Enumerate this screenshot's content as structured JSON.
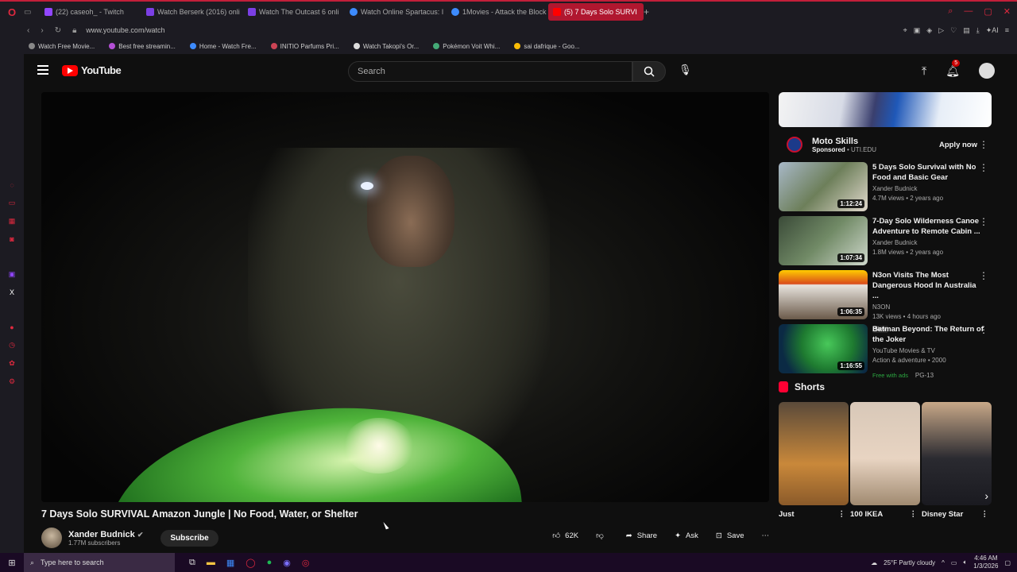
{
  "browser": {
    "tabs": [
      {
        "label": "(22) caseoh_ - Twitch",
        "color": "#9146ff"
      },
      {
        "label": "Watch Berserk (2016) onli",
        "color": "#7b3fe4"
      },
      {
        "label": "Watch The Outcast 6 onli",
        "color": "#7b3fe4"
      },
      {
        "label": "Watch Online Spartacus: I",
        "color": "#3d8bfd"
      },
      {
        "label": "1Movies - Attack the Block",
        "color": "#3d8bfd"
      },
      {
        "label": "(5) 7 Days Solo SURVI",
        "color": "#ff0000"
      }
    ],
    "url": "www.youtube.com/watch",
    "bookmarks": [
      "Watch Free Movie...",
      "Best free streamin...",
      "Home - Watch Fre...",
      "INITIO Parfums Pri...",
      "Watch Takopi's Or...",
      "Pokémon Voit Whi...",
      "sai dafrique - Goo..."
    ]
  },
  "youtube": {
    "logo": "YouTube",
    "search_placeholder": "Search",
    "notif_count": "5",
    "video": {
      "title": "7 Days Solo SURVIVAL Amazon Jungle | No Food, Water, or Shelter",
      "channel": "Xander Budnick",
      "subs": "1.77M subscribers",
      "subscribe": "Subscribe",
      "likes": "62K",
      "share": "Share",
      "ask": "Ask",
      "save": "Save"
    },
    "ad": {
      "name": "Moto Skills",
      "sponsored": "Sponsored",
      "domain": "UTI.EDU",
      "cta": "Apply now"
    },
    "recommendations": [
      {
        "title": "5 Days Solo Survival with No Food and Basic Gear",
        "channel": "Xander Budnick",
        "stats": "4.7M views • 2 years ago",
        "duration": "1:12:24"
      },
      {
        "title": "7-Day Solo Wilderness Canoe Adventure to Remote Cabin ...",
        "channel": "Xander Budnick",
        "stats": "1.8M views • 2 years ago",
        "duration": "1:07:34"
      },
      {
        "title": "N3on Visits The Most Dangerous Hood In Australia ...",
        "channel": "N3ON",
        "stats": "13K views • 4 hours ago",
        "duration": "1:06:35",
        "badge": "New"
      },
      {
        "title": "Batman Beyond: The Return of the Joker",
        "channel": "YouTube Movies & TV",
        "stats": "Action & adventure • 2000",
        "duration": "1:16:55",
        "free": "Free with ads",
        "rating": "PG-13"
      }
    ],
    "shorts_label": "Shorts",
    "shorts": [
      "Just",
      "100 IKEA",
      "Disney Star"
    ]
  },
  "taskbar": {
    "search": "Type here to search",
    "weather": "25°F  Partly cloudy",
    "time": "4:46 AM",
    "date": "1/3/2026"
  }
}
